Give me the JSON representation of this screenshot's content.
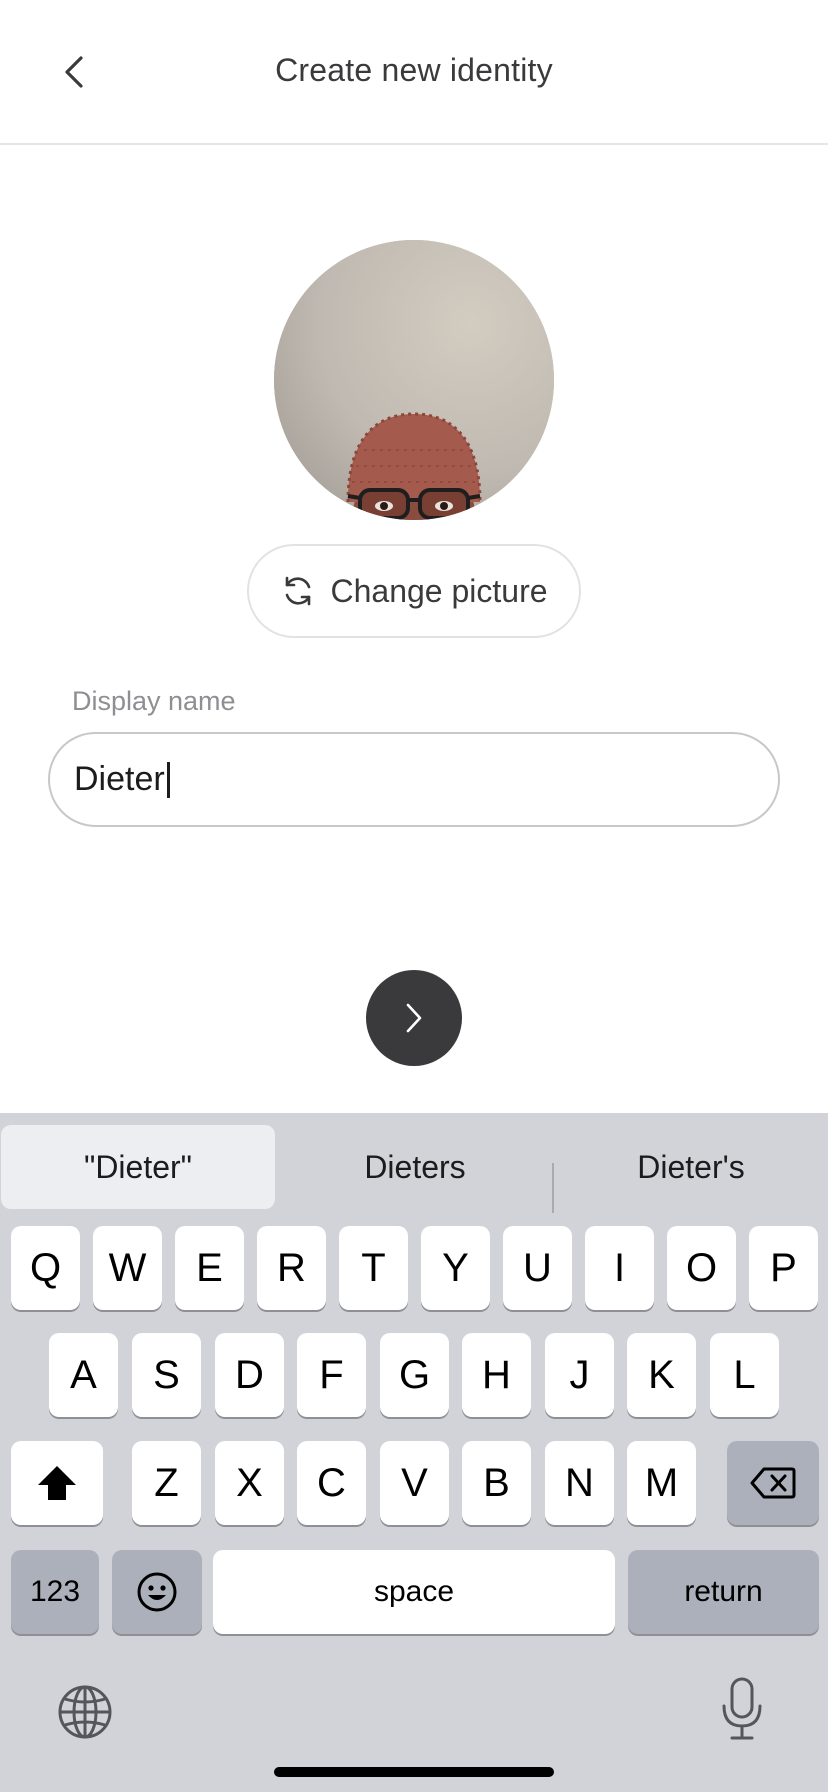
{
  "header": {
    "title": "Create new identity",
    "back_icon": "chevron-left-icon"
  },
  "avatar": {
    "alt": "profile-photo"
  },
  "change_picture": {
    "label": "Change picture",
    "icon": "refresh-icon"
  },
  "display_name": {
    "label": "Display name",
    "value": "Dieter"
  },
  "next_button": {
    "icon": "chevron-right-icon",
    "color": "#3a3a3c"
  },
  "keyboard": {
    "suggestions": [
      "\"Dieter\"",
      "Dieters",
      "Dieter's"
    ],
    "row1": [
      "Q",
      "W",
      "E",
      "R",
      "T",
      "Y",
      "U",
      "I",
      "O",
      "P"
    ],
    "row2": [
      "A",
      "S",
      "D",
      "F",
      "G",
      "H",
      "J",
      "K",
      "L"
    ],
    "row3": [
      "Z",
      "X",
      "C",
      "V",
      "B",
      "N",
      "M"
    ],
    "numbers_label": "123",
    "space_label": "space",
    "return_label": "return",
    "shift_icon": "shift-icon",
    "delete_icon": "backspace-icon",
    "emoji_icon": "emoji-icon",
    "globe_icon": "globe-icon",
    "mic_icon": "microphone-icon"
  }
}
